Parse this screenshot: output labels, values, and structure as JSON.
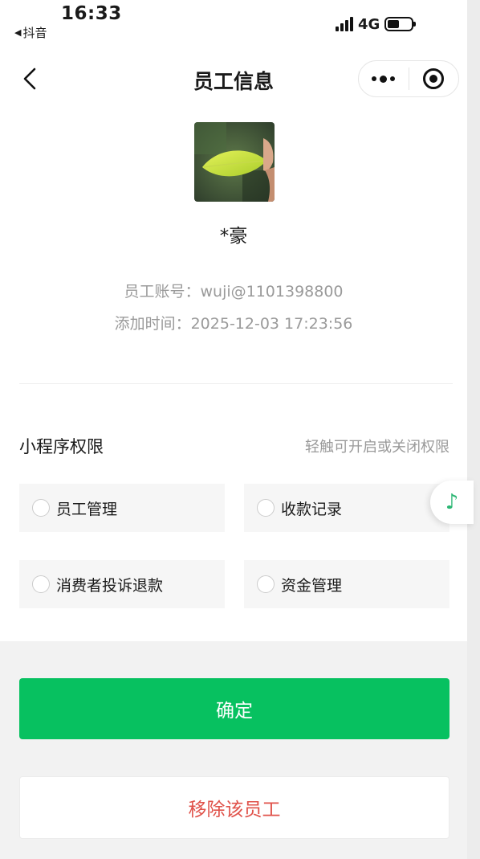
{
  "status_bar": {
    "time": "16:33",
    "back_app": "抖音",
    "network": "4G",
    "icons": {
      "signal": "signal-icon",
      "battery": "battery-icon"
    }
  },
  "nav": {
    "title": "员工信息",
    "icons": {
      "back": "chevron-left-icon",
      "more": "more-dots-icon",
      "close": "target-close-icon"
    }
  },
  "employee": {
    "avatar_icon": "leaf-avatar",
    "name": "*豪",
    "account_line": "员工账号：wuji@1101398800",
    "added_time_line": "添加时间：2025-12-03 17:23:56"
  },
  "permissions": {
    "title": "小程序权限",
    "hint": "轻触可开启或关闭权限",
    "options": [
      {
        "label": "员工管理",
        "checked": false
      },
      {
        "label": "收款记录",
        "checked": false
      },
      {
        "label": "消费者投诉退款",
        "checked": false
      },
      {
        "label": "资金管理",
        "checked": false
      }
    ]
  },
  "floating": {
    "icon": "music-note-icon",
    "glyph": "♪"
  },
  "actions": {
    "confirm_label": "确定",
    "remove_label": "移除该员工"
  },
  "colors": {
    "accent_green": "#07c160",
    "danger_red": "#e0524a",
    "muted_text": "#9a9a9a"
  }
}
